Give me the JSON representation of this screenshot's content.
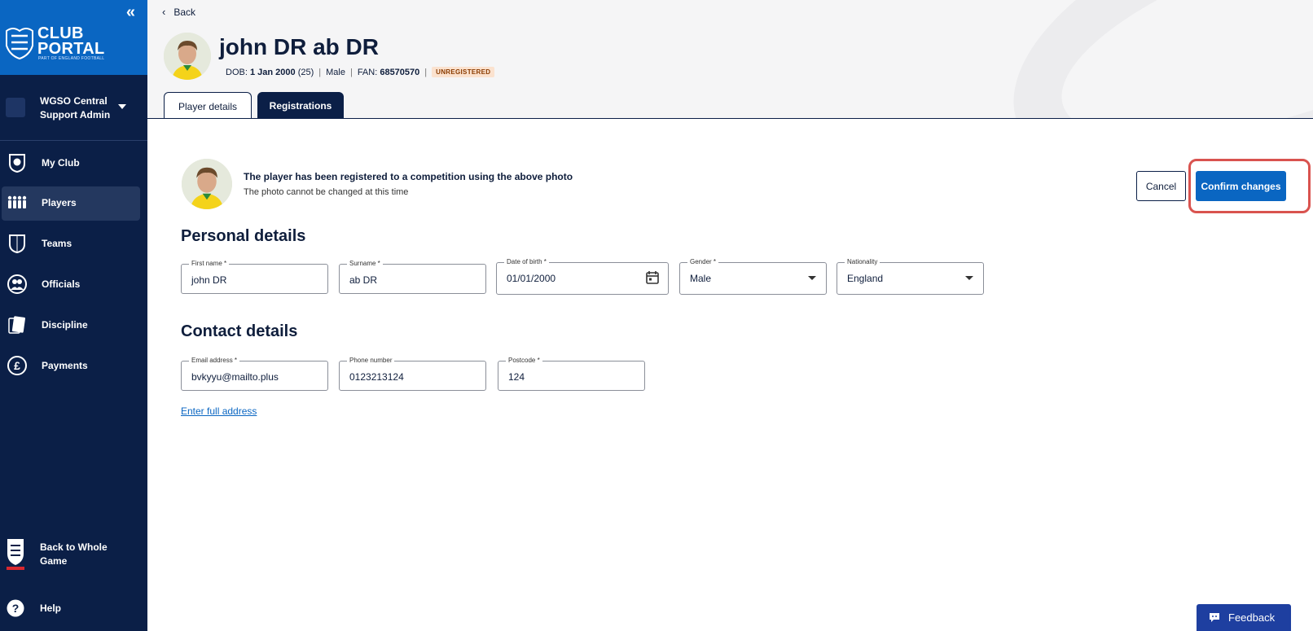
{
  "sidebar": {
    "collapse_glyph": "«",
    "logo": {
      "line1": "CLUB",
      "line2": "PORTAL",
      "sub": "PART OF ENGLAND FOOTBALL"
    },
    "account": {
      "line1": "WGSO Central",
      "line2": "Support Admin"
    },
    "items": [
      {
        "label": "My Club",
        "icon": "club-crest-icon"
      },
      {
        "label": "Players",
        "icon": "players-icon",
        "active": true
      },
      {
        "label": "Teams",
        "icon": "shield-icon"
      },
      {
        "label": "Officials",
        "icon": "officials-icon"
      },
      {
        "label": "Discipline",
        "icon": "card-icon"
      },
      {
        "label": "Payments",
        "icon": "pound-icon"
      }
    ],
    "back_to_whole_game": {
      "line1": "Back to Whole",
      "line2": "Game",
      "icon": "england-crest-icon"
    },
    "help": {
      "label": "Help",
      "icon": "help-icon"
    }
  },
  "header": {
    "back_label": "Back",
    "player_name": "john DR ab DR",
    "dob_label": "DOB:",
    "dob_value": "1 Jan 2000",
    "age": "(25)",
    "gender": "Male",
    "fan_label": "FAN:",
    "fan_value": "68570570",
    "status_badge": "UNREGISTERED",
    "tabs": [
      {
        "label": "Player details",
        "active": true
      },
      {
        "label": "Registrations",
        "active": false
      }
    ]
  },
  "photo_notice": {
    "title": "The player has been registered to a competition using the above photo",
    "subtitle": "The photo cannot be changed at this time"
  },
  "actions": {
    "cancel_label": "Cancel",
    "confirm_label": "Confirm changes"
  },
  "personal": {
    "title": "Personal details",
    "first_name": {
      "label": "First name *",
      "value": "john DR"
    },
    "surname": {
      "label": "Surname *",
      "value": "ab DR"
    },
    "dob": {
      "label": "Date of birth *",
      "value": "01/01/2000"
    },
    "gender": {
      "label": "Gender *",
      "value": "Male"
    },
    "nationality": {
      "label": "Nationality",
      "value": "England"
    }
  },
  "contact": {
    "title": "Contact details",
    "email": {
      "label": "Email address *",
      "value": "bvkyyu@mailto.plus"
    },
    "phone": {
      "label": "Phone number",
      "value": "0123213124"
    },
    "postcode": {
      "label": "Postcode *",
      "value": "124"
    },
    "full_address_link": "Enter full address"
  },
  "feedback_label": "Feedback",
  "colors": {
    "navy": "#0b1f47",
    "brand_blue": "#0a66c2",
    "highlight_red": "#d9534f",
    "badge_bg": "#fbe2cf"
  }
}
